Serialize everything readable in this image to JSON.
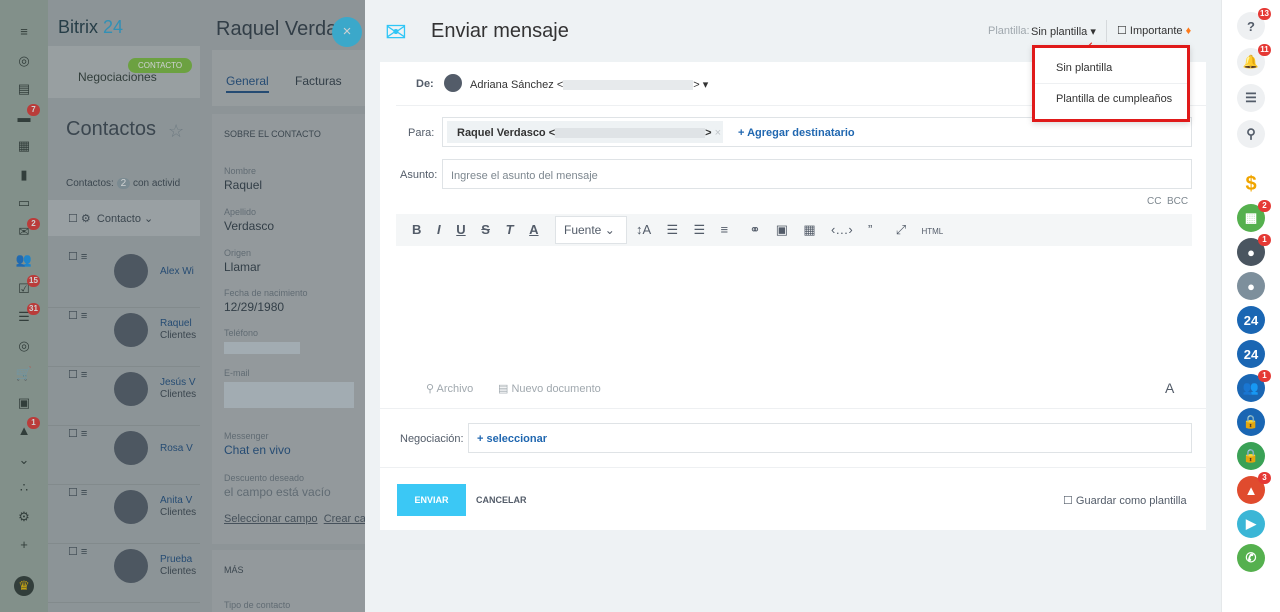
{
  "leftbar": {
    "items": [
      {
        "icon": "menu-icon"
      },
      {
        "icon": "target-icon"
      },
      {
        "icon": "calendar-icon"
      },
      {
        "icon": "chat-icon",
        "badge": "7"
      },
      {
        "icon": "grid-icon"
      },
      {
        "icon": "doc-icon"
      },
      {
        "icon": "drive-icon"
      },
      {
        "icon": "mail-icon",
        "badge": "2"
      },
      {
        "icon": "users-icon"
      },
      {
        "icon": "tasks-icon",
        "badge": "15"
      },
      {
        "icon": "filter-icon",
        "badge": "31"
      },
      {
        "icon": "target2-icon"
      },
      {
        "icon": "cart-icon"
      },
      {
        "icon": "contacts-icon"
      },
      {
        "icon": "rocket-icon",
        "badge": "1"
      },
      {
        "icon": "chevron-down-icon"
      },
      {
        "icon": "share-icon"
      },
      {
        "icon": "settings-icon"
      },
      {
        "icon": "plus-icon"
      },
      {
        "icon": "crown-icon"
      }
    ]
  },
  "crm": {
    "brand": "Bitrix",
    "brand_num": "24",
    "deals_tab": "Negociaciones",
    "contact_tab": "CONTACTO",
    "title": "Contactos",
    "counter_label": "Contactos:",
    "counter": "2",
    "counter_suffix": "con activid",
    "column": "Contacto",
    "rows": [
      {
        "name": "Alex Wi",
        "type": ""
      },
      {
        "name": "Raquel",
        "type": "Clientes"
      },
      {
        "name": "Jesús V",
        "type": "Clientes"
      },
      {
        "name": "Rosa V",
        "type": ""
      },
      {
        "name": "Anita V",
        "type": "Clientes"
      },
      {
        "name": "Prueba",
        "type": "Clientes"
      }
    ]
  },
  "contact": {
    "name": "Raquel Verdasco",
    "tabs": [
      "General",
      "Facturas"
    ],
    "section": "SOBRE EL CONTACTO",
    "fields": [
      {
        "label": "Nombre",
        "value": "Raquel"
      },
      {
        "label": "Apellido",
        "value": "Verdasco"
      },
      {
        "label": "Origen",
        "value": "Llamar"
      },
      {
        "label": "Fecha de nacimiento",
        "value": "12/29/1980"
      },
      {
        "label": "Teléfono",
        "value": ""
      },
      {
        "label": "E-mail",
        "value": ""
      },
      {
        "label": "Messenger",
        "value": "Chat en vivo"
      },
      {
        "label": "Descuento deseado",
        "value": "el campo está vacío"
      }
    ],
    "select_field": "Seleccionar campo",
    "create_field": "Crear ca",
    "more": "MÁS",
    "contact_type": "Tipo de contacto"
  },
  "email": {
    "title": "Enviar mensaje",
    "template_label": "Plantilla:",
    "template_value": "Sin plantilla",
    "important": "Importante",
    "template_options": [
      "Sin plantilla",
      "Plantilla de cumpleaños"
    ],
    "from_label": "De:",
    "from_value": "Adriana Sánchez <",
    "from_tail": ">",
    "to_label": "Para:",
    "to_value": "Raquel Verdasco <",
    "to_tail": ">",
    "add_recipient": "+ Agregar destinatario",
    "subject_label": "Asunto:",
    "subject_placeholder": "Ingrese el asunto del mensaje",
    "cc": "CC",
    "bcc": "BCC",
    "font_label": "Fuente",
    "attach_file": "Archivo",
    "new_document": "Nuevo documento",
    "deal_label": "Negociación:",
    "deal_select": "+ seleccionar",
    "send": "ENVIAR",
    "cancel": "CANCELAR",
    "save_template": "Guardar como plantilla",
    "format_letter": "A"
  },
  "rightbar": {
    "items": [
      {
        "icon": "help-icon",
        "badge": "13",
        "color": "#6b7a86"
      },
      {
        "icon": "bell-icon",
        "badge": "11",
        "color": "#6b7a86"
      },
      {
        "icon": "messenger-icon",
        "color": "#6b7a86"
      },
      {
        "icon": "search-icon",
        "color": "#6b7a86"
      },
      {
        "icon": "dollar-icon",
        "color": "#f0a500"
      },
      {
        "icon": "calendar-user-icon",
        "badge": "2",
        "color": "#55b04e"
      },
      {
        "icon": "avatar-group-icon",
        "badge": "1",
        "color": "#4a5560"
      },
      {
        "icon": "avatar-icon",
        "color": "#7d8f9c"
      },
      {
        "icon": "b24-icon",
        "text": "24",
        "color": "#1a66b3"
      },
      {
        "icon": "b24-icon",
        "text": "24",
        "color": "#1a66b3"
      },
      {
        "icon": "group-chat-icon",
        "badge": "1",
        "color": "#1a66b3"
      },
      {
        "icon": "lock-icon",
        "color": "#1a66b3"
      },
      {
        "icon": "lock-icon",
        "color": "#3aa156"
      },
      {
        "icon": "open-line-icon",
        "badge": "3",
        "color": "#e04b2e"
      },
      {
        "icon": "telephony-icon",
        "color": "#3bb6d6"
      },
      {
        "icon": "phone-icon",
        "color": "#55b04e"
      }
    ]
  }
}
